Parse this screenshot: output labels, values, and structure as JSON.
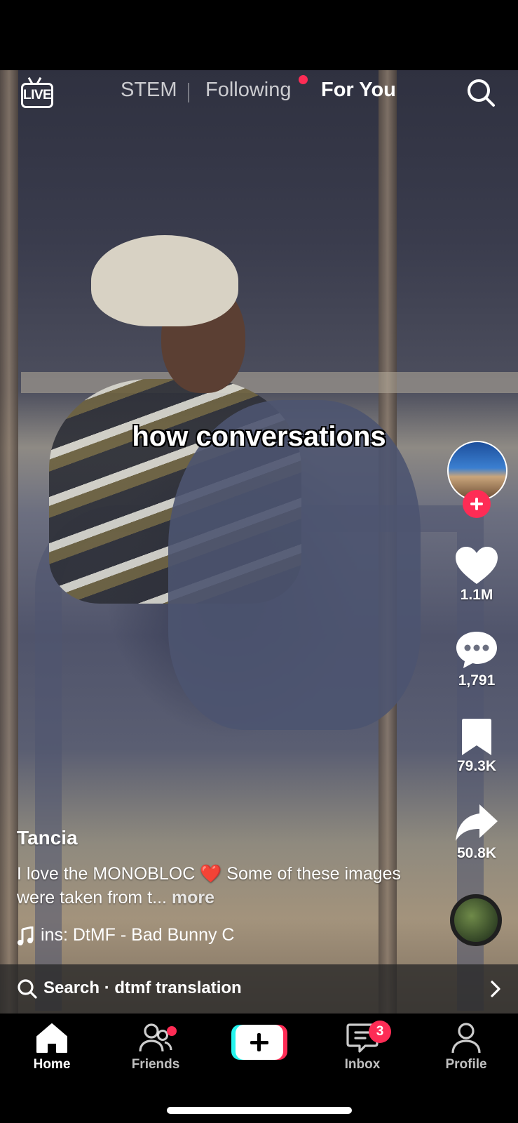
{
  "top_nav": {
    "live_label": "LIVE",
    "tabs": [
      {
        "label": "STEM"
      },
      {
        "label": "Following"
      },
      {
        "label": "For You"
      }
    ]
  },
  "video": {
    "caption": "how conversations"
  },
  "actions": {
    "likes": "1.1M",
    "comments": "1,791",
    "bookmarks": "79.3K",
    "shares": "50.8K"
  },
  "post": {
    "username": "Tancia",
    "description_part1": "I love the MONOBLOC ",
    "description_emoji": "❤️",
    "description_part2": " Some of these images were taken from t... ",
    "more_label": "more",
    "music": "ins: DtMF - Bad Bunny     C"
  },
  "search_bar": {
    "text": "Search · dtmf translation"
  },
  "bottom_nav": {
    "items": [
      {
        "label": "Home"
      },
      {
        "label": "Friends"
      },
      {
        "label": "Inbox"
      },
      {
        "label": "Profile"
      }
    ],
    "inbox_badge": "3"
  },
  "colors": {
    "accent": "#fe2c55",
    "cyan": "#25f4ee"
  },
  "icons": [
    "live-icon",
    "search-icon",
    "heart-icon",
    "comment-icon",
    "bookmark-icon",
    "share-icon",
    "music-note-icon",
    "home-icon",
    "friends-icon",
    "plus-icon",
    "inbox-icon",
    "profile-icon",
    "chevron-right-icon"
  ]
}
